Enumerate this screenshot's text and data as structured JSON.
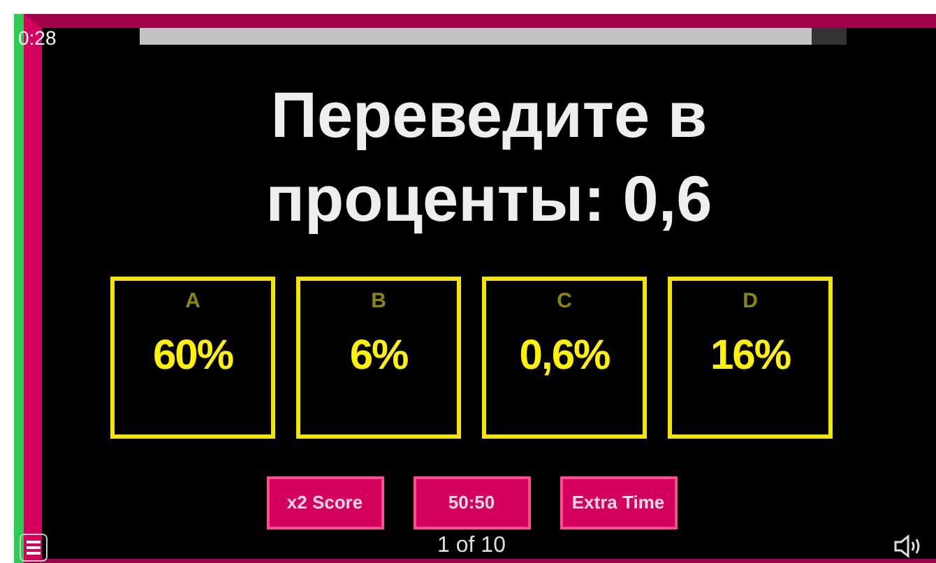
{
  "timer": {
    "text": "0:28",
    "level": 0.95
  },
  "question": "Переведите в проценты: 0,6",
  "answers": [
    {
      "letter": "A",
      "text": "60%"
    },
    {
      "letter": "B",
      "text": "6%"
    },
    {
      "letter": "C",
      "text": "0,6%"
    },
    {
      "letter": "D",
      "text": "16%"
    }
  ],
  "powerups": [
    "x2 Score",
    "50:50",
    "Extra Time"
  ],
  "progress": "1 of 10"
}
